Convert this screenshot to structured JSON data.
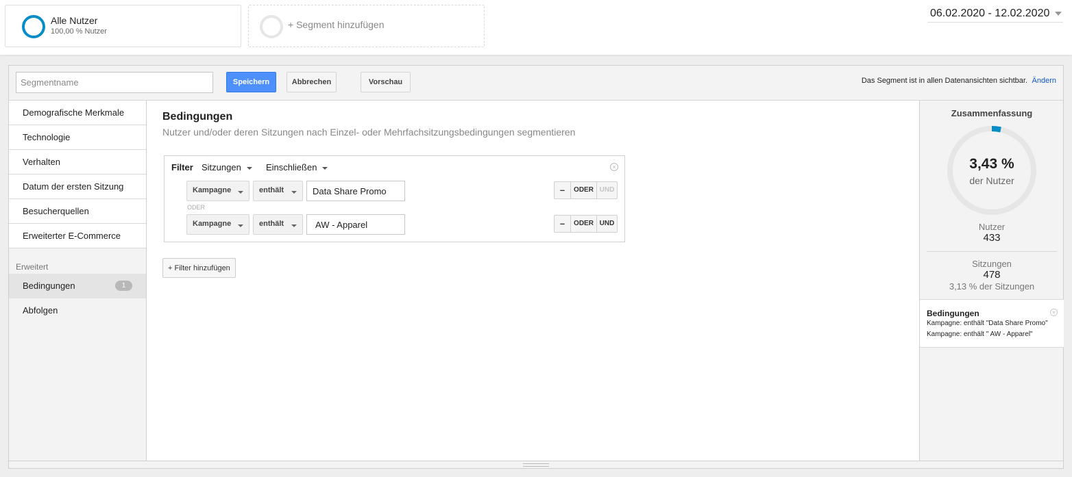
{
  "segments": {
    "active": {
      "title": "Alle Nutzer",
      "subtitle": "100,00 % Nutzer"
    },
    "add_label": "+ Segment hinzufügen"
  },
  "date_range": "06.02.2020 - 12.02.2020",
  "toolbar": {
    "name_placeholder": "Segmentname",
    "save_label": "Speichern",
    "cancel_label": "Abbrechen",
    "preview_label": "Vorschau",
    "visibility_text": "Das Segment ist in allen Datenansichten sichtbar.",
    "change_label": "Ändern"
  },
  "nav": {
    "items": [
      {
        "label": "Demografische Merkmale"
      },
      {
        "label": "Technologie"
      },
      {
        "label": "Verhalten"
      },
      {
        "label": "Datum der ersten Sitzung"
      },
      {
        "label": "Besucherquellen"
      },
      {
        "label": "Erweiterter E-Commerce"
      }
    ],
    "advanced_heading": "Erweitert",
    "advanced_items": [
      {
        "label": "Bedingungen",
        "badge": "1",
        "selected": true
      },
      {
        "label": "Abfolgen"
      }
    ]
  },
  "main": {
    "title": "Bedingungen",
    "subtitle": "Nutzer und/oder deren Sitzungen nach Einzel- oder Mehrfachsitzungsbedingungen segmentieren",
    "filter": {
      "label": "Filter",
      "scope": "Sitzungen",
      "mode": "Einschließen",
      "rows": [
        {
          "dimension": "Kampagne",
          "operator": "enthält",
          "value": "Data Share Promo",
          "minus": "–",
          "or": "ODER",
          "and": "UND",
          "and_enabled": false
        },
        {
          "dimension": "Kampagne",
          "operator": "enthält",
          "value": "AW - Apparel",
          "minus": "–",
          "or": "ODER",
          "and": "UND",
          "and_enabled": true
        }
      ],
      "or_separator": "ODER"
    },
    "add_filter_label": "+ Filter hinzufügen"
  },
  "summary": {
    "title": "Zusammenfassung",
    "gauge_percent": 3.43,
    "gauge_value": "3,43 %",
    "gauge_label": "der Nutzer",
    "users_label": "Nutzer",
    "users_value": "433",
    "sessions_label": "Sitzungen",
    "sessions_value": "478",
    "sessions_percent": "3,13 % der Sitzungen",
    "conditions_title": "Bedingungen",
    "conditions_lines": [
      "Kampagne: enthält \"Data Share Promo\"",
      "Kampagne: enthält \" AW - Apparel\""
    ]
  },
  "colors": {
    "accent": "#058dc7",
    "primary_button": "#4d90fe",
    "link": "#1155cc",
    "gauge_track": "#e6e6e6"
  }
}
